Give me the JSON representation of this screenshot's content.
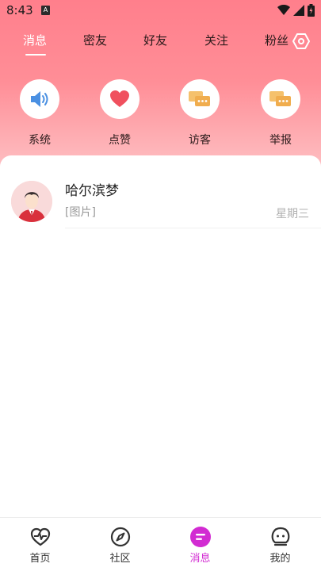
{
  "status_bar": {
    "time": "8:43",
    "app_badge": "A"
  },
  "tabs": [
    {
      "label": "消息",
      "active": true
    },
    {
      "label": "密友",
      "active": false
    },
    {
      "label": "好友",
      "active": false
    },
    {
      "label": "关注",
      "active": false
    },
    {
      "label": "粉丝",
      "active": false
    }
  ],
  "quick_actions": [
    {
      "label": "系统",
      "icon": "speaker-icon"
    },
    {
      "label": "点赞",
      "icon": "heart-icon"
    },
    {
      "label": "访客",
      "icon": "chat-bubbles-icon"
    },
    {
      "label": "举报",
      "icon": "chat-bubbles-icon"
    }
  ],
  "conversations": [
    {
      "name": "哈尔滨梦",
      "preview": "[图片]",
      "time": "星期三"
    }
  ],
  "bottom_nav": [
    {
      "label": "首页",
      "icon": "heartbeat-icon",
      "active": false
    },
    {
      "label": "社区",
      "icon": "compass-icon",
      "active": false
    },
    {
      "label": "消息",
      "icon": "message-icon",
      "active": true
    },
    {
      "label": "我的",
      "icon": "profile-icon",
      "active": false
    }
  ],
  "colors": {
    "accent": "#d22bd2",
    "header_top": "#ff7f8c",
    "header_bottom": "#fdc7c9"
  }
}
